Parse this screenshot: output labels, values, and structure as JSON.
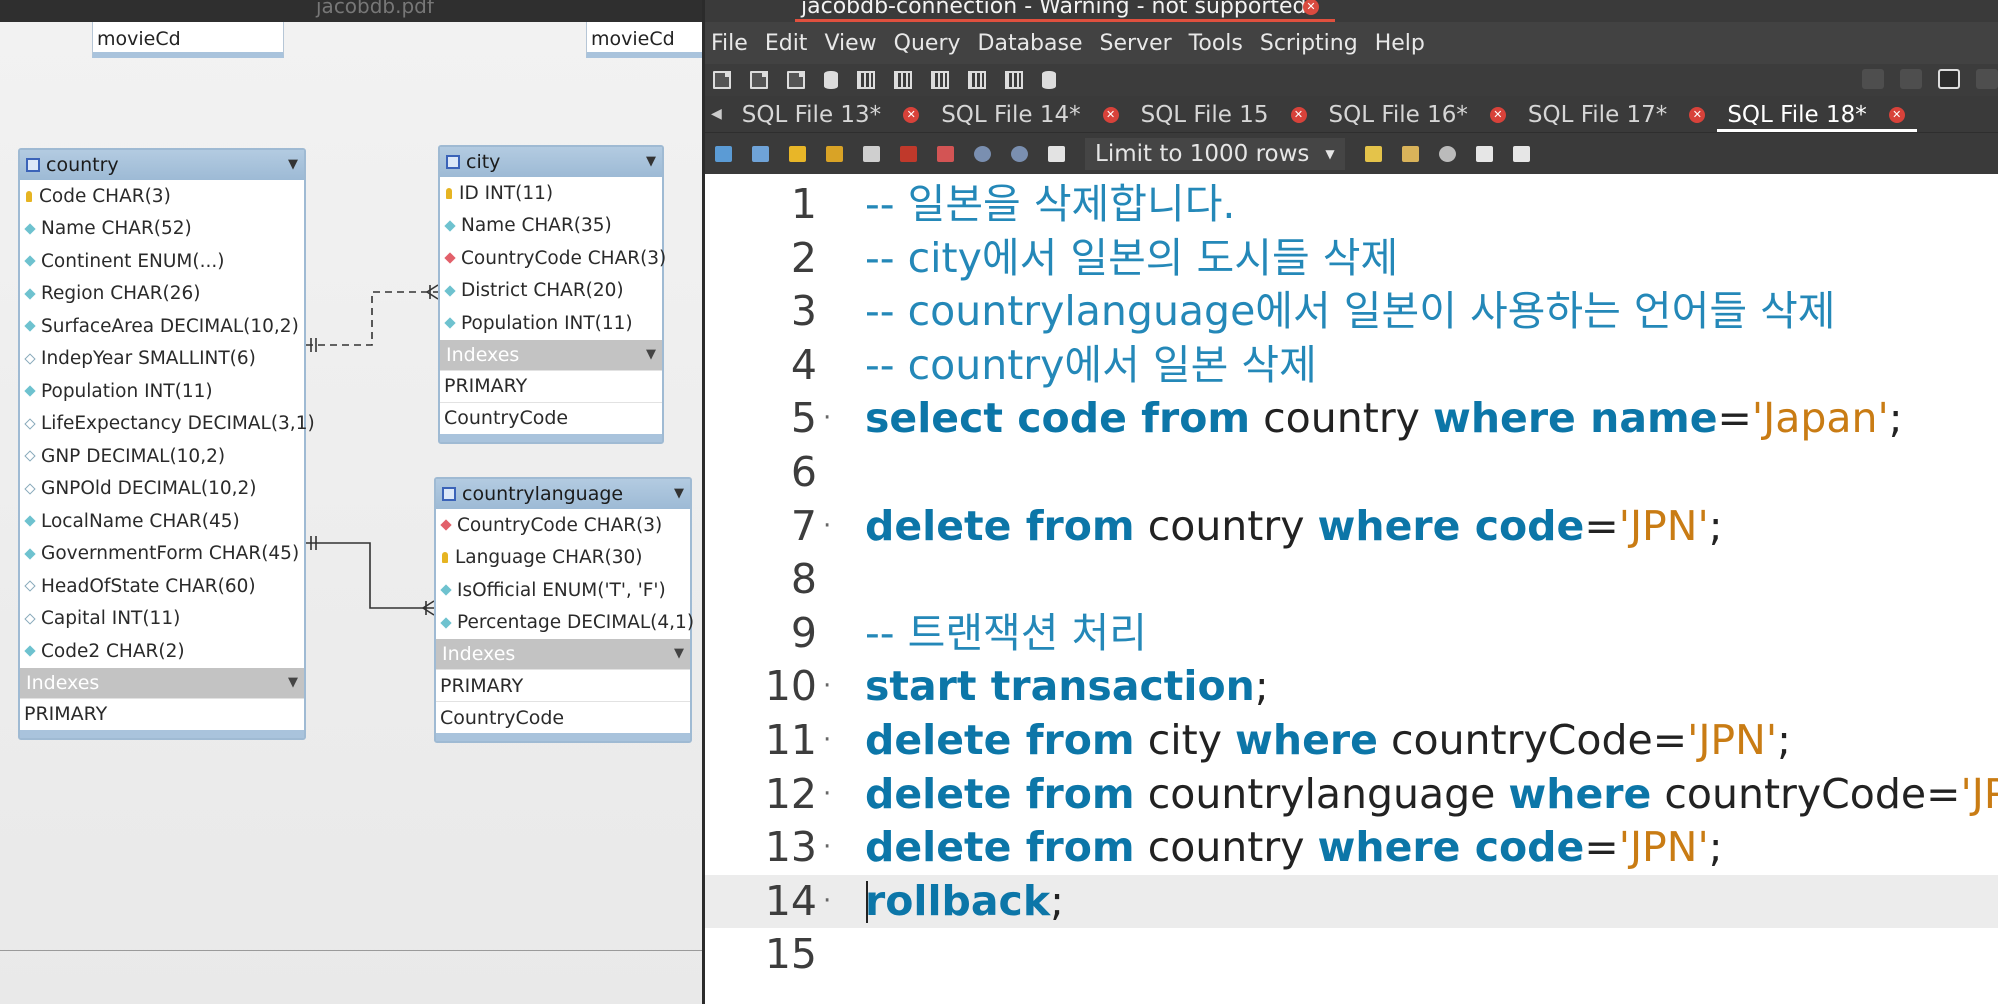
{
  "diagram": {
    "top_filename": "jacobdb.pdf",
    "partials": [
      "movieCd",
      "movieCd"
    ],
    "country": {
      "title": "country",
      "columns": [
        {
          "name": "Code CHAR(3)",
          "key": "key"
        },
        {
          "name": "Name CHAR(52)",
          "key": "col"
        },
        {
          "name": "Continent ENUM(...)",
          "key": "col"
        },
        {
          "name": "Region CHAR(26)",
          "key": "col"
        },
        {
          "name": "SurfaceArea DECIMAL(10,2)",
          "key": "col"
        },
        {
          "name": "IndepYear SMALLINT(6)",
          "key": "open"
        },
        {
          "name": "Population INT(11)",
          "key": "col"
        },
        {
          "name": "LifeExpectancy DECIMAL(3,1)",
          "key": "open"
        },
        {
          "name": "GNP DECIMAL(10,2)",
          "key": "open"
        },
        {
          "name": "GNPOld DECIMAL(10,2)",
          "key": "open"
        },
        {
          "name": "LocalName CHAR(45)",
          "key": "col"
        },
        {
          "name": "GovernmentForm CHAR(45)",
          "key": "col"
        },
        {
          "name": "HeadOfState CHAR(60)",
          "key": "open"
        },
        {
          "name": "Capital INT(11)",
          "key": "open"
        },
        {
          "name": "Code2 CHAR(2)",
          "key": "col"
        }
      ],
      "indexes_label": "Indexes",
      "indexes": [
        "PRIMARY"
      ]
    },
    "city": {
      "title": "city",
      "columns": [
        {
          "name": "ID INT(11)",
          "key": "key"
        },
        {
          "name": "Name CHAR(35)",
          "key": "col"
        },
        {
          "name": "CountryCode CHAR(3)",
          "key": "fk"
        },
        {
          "name": "District CHAR(20)",
          "key": "col"
        },
        {
          "name": "Population INT(11)",
          "key": "col"
        }
      ],
      "indexes_label": "Indexes",
      "indexes": [
        "PRIMARY",
        "CountryCode"
      ]
    },
    "countrylanguage": {
      "title": "countrylanguage",
      "columns": [
        {
          "name": "CountryCode CHAR(3)",
          "key": "fk"
        },
        {
          "name": "Language CHAR(30)",
          "key": "key"
        },
        {
          "name": "IsOfficial ENUM('T', 'F')",
          "key": "col"
        },
        {
          "name": "Percentage DECIMAL(4,1)",
          "key": "col"
        }
      ],
      "indexes_label": "Indexes",
      "indexes": [
        "PRIMARY",
        "CountryCode"
      ]
    }
  },
  "workbench": {
    "window_title": "jacobdb-connection - Warning - not supported",
    "menu": [
      "File",
      "Edit",
      "View",
      "Query",
      "Database",
      "Server",
      "Tools",
      "Scripting",
      "Help"
    ],
    "tabs": [
      {
        "label": "SQL File 13*",
        "active": false
      },
      {
        "label": "SQL File 14*",
        "active": false
      },
      {
        "label": "SQL File 15",
        "active": false
      },
      {
        "label": "SQL File 16*",
        "active": false
      },
      {
        "label": "SQL File 17*",
        "active": false
      },
      {
        "label": "SQL File 18*",
        "active": true
      }
    ],
    "limit_label": "Limit to 1000 rows",
    "current_line": 14,
    "lines": [
      {
        "n": "1",
        "dot": false,
        "tokens": [
          {
            "t": "cm",
            "v": "-- 일본을 삭제합니다."
          }
        ]
      },
      {
        "n": "2",
        "dot": false,
        "tokens": [
          {
            "t": "cm",
            "v": "-- city에서 일본의 도시들 삭제"
          }
        ]
      },
      {
        "n": "3",
        "dot": false,
        "tokens": [
          {
            "t": "cm",
            "v": "-- countrylanguage에서 일본이 사용하는 언어들 삭제"
          }
        ]
      },
      {
        "n": "4",
        "dot": false,
        "tokens": [
          {
            "t": "cm",
            "v": "-- country에서 일본 삭제"
          }
        ]
      },
      {
        "n": "5",
        "dot": true,
        "tokens": [
          {
            "t": "kw",
            "v": "select code from"
          },
          {
            "t": "id",
            "v": " country "
          },
          {
            "t": "kw",
            "v": "where name"
          },
          {
            "t": "id",
            "v": "="
          },
          {
            "t": "str",
            "v": "'Japan'"
          },
          {
            "t": "id",
            "v": ";"
          }
        ]
      },
      {
        "n": "6",
        "dot": false,
        "tokens": []
      },
      {
        "n": "7",
        "dot": true,
        "tokens": [
          {
            "t": "kw",
            "v": "delete from"
          },
          {
            "t": "id",
            "v": " country "
          },
          {
            "t": "kw",
            "v": "where code"
          },
          {
            "t": "id",
            "v": "="
          },
          {
            "t": "str",
            "v": "'JPN'"
          },
          {
            "t": "id",
            "v": ";"
          }
        ]
      },
      {
        "n": "8",
        "dot": false,
        "tokens": []
      },
      {
        "n": "9",
        "dot": false,
        "tokens": [
          {
            "t": "cm",
            "v": "-- 트랜잭션 처리"
          }
        ]
      },
      {
        "n": "10",
        "dot": true,
        "tokens": [
          {
            "t": "kw",
            "v": "start transaction"
          },
          {
            "t": "id",
            "v": ";"
          }
        ]
      },
      {
        "n": "11",
        "dot": true,
        "tokens": [
          {
            "t": "kw",
            "v": "delete from"
          },
          {
            "t": "id",
            "v": " city "
          },
          {
            "t": "kw",
            "v": "where"
          },
          {
            "t": "id",
            "v": " countryCode="
          },
          {
            "t": "str",
            "v": "'JPN'"
          },
          {
            "t": "id",
            "v": ";"
          }
        ]
      },
      {
        "n": "12",
        "dot": true,
        "tokens": [
          {
            "t": "kw",
            "v": "delete from"
          },
          {
            "t": "id",
            "v": " countrylanguage "
          },
          {
            "t": "kw",
            "v": "where"
          },
          {
            "t": "id",
            "v": " countryCode="
          },
          {
            "t": "str",
            "v": "'JPN'"
          },
          {
            "t": "id",
            "v": ";"
          }
        ]
      },
      {
        "n": "13",
        "dot": true,
        "tokens": [
          {
            "t": "kw",
            "v": "delete from"
          },
          {
            "t": "id",
            "v": " country "
          },
          {
            "t": "kw",
            "v": "where code"
          },
          {
            "t": "id",
            "v": "="
          },
          {
            "t": "str",
            "v": "'JPN'"
          },
          {
            "t": "id",
            "v": ";"
          }
        ]
      },
      {
        "n": "14",
        "dot": true,
        "tokens": [
          {
            "t": "kw",
            "v": "rollback"
          },
          {
            "t": "id",
            "v": ";"
          }
        ]
      },
      {
        "n": "15",
        "dot": false,
        "tokens": []
      }
    ]
  }
}
